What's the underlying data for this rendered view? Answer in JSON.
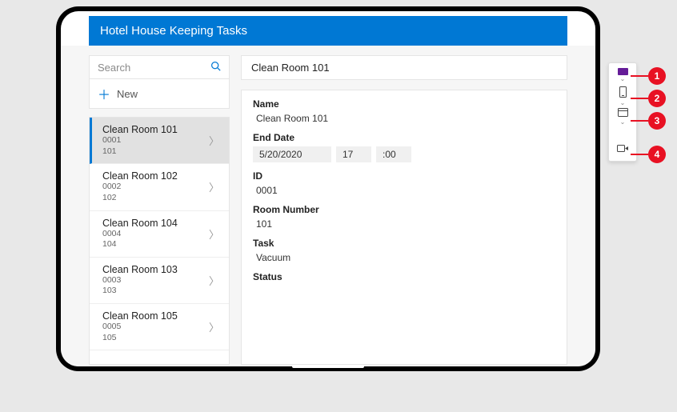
{
  "header": {
    "title": "Hotel House Keeping Tasks"
  },
  "search": {
    "placeholder": "Search"
  },
  "newButton": {
    "label": "New"
  },
  "list": {
    "items": [
      {
        "title": "Clean Room 101",
        "id": "0001",
        "room": "101",
        "selected": true
      },
      {
        "title": "Clean Room 102",
        "id": "0002",
        "room": "102",
        "selected": false
      },
      {
        "title": "Clean Room 104",
        "id": "0004",
        "room": "104",
        "selected": false
      },
      {
        "title": "Clean Room 103",
        "id": "0003",
        "room": "103",
        "selected": false
      },
      {
        "title": "Clean Room 105",
        "id": "0005",
        "room": "105",
        "selected": false
      }
    ]
  },
  "detail": {
    "title": "Clean Room 101",
    "labels": {
      "name": "Name",
      "endDate": "End Date",
      "id": "ID",
      "roomNumber": "Room Number",
      "task": "Task",
      "status": "Status"
    },
    "values": {
      "name": "Clean Room 101",
      "endDate": {
        "date": "5/20/2020",
        "hour": "17",
        "minute": ":00"
      },
      "id": "0001",
      "roomNumber": "101",
      "task": "Vacuum",
      "status": ""
    }
  },
  "toolbar": {
    "items": [
      {
        "name": "card-icon"
      },
      {
        "name": "mobile-icon"
      },
      {
        "name": "browser-icon"
      },
      {
        "name": "record-icon"
      }
    ]
  },
  "callouts": [
    "1",
    "2",
    "3",
    "4"
  ]
}
